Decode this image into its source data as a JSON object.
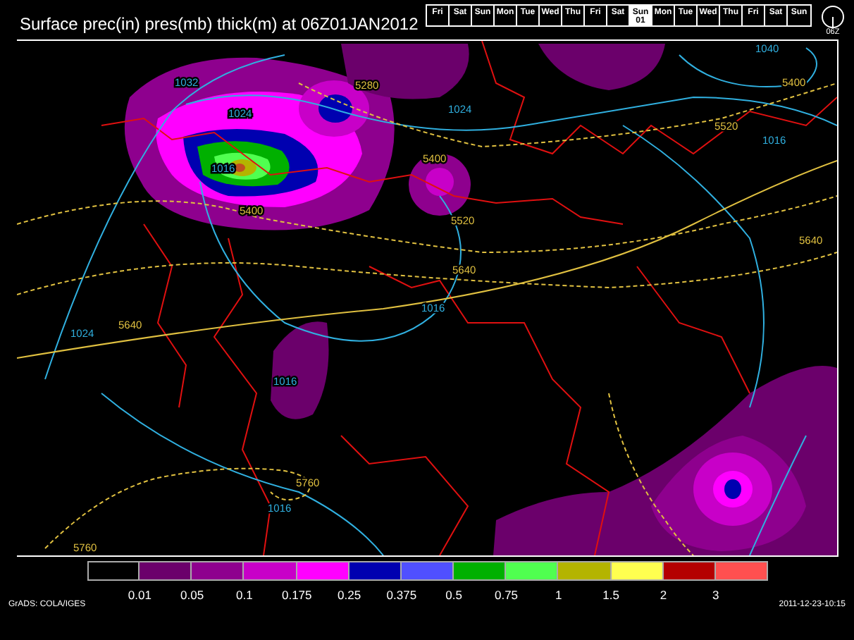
{
  "title": "Surface prec(in) pres(mb) thick(m) at 06Z01JAN2012",
  "days": [
    {
      "day": "Fri",
      "selected": false
    },
    {
      "day": "Sat",
      "selected": false
    },
    {
      "day": "Sun",
      "selected": false
    },
    {
      "day": "Mon",
      "selected": false
    },
    {
      "day": "Tue",
      "selected": false
    },
    {
      "day": "Wed",
      "selected": false
    },
    {
      "day": "Thu",
      "selected": false
    },
    {
      "day": "Fri",
      "selected": false
    },
    {
      "day": "Sat",
      "selected": false
    },
    {
      "day": "Sun",
      "date": "01",
      "selected": true
    },
    {
      "day": "Mon",
      "selected": false
    },
    {
      "day": "Tue",
      "selected": false
    },
    {
      "day": "Wed",
      "selected": false
    },
    {
      "day": "Thu",
      "selected": false
    },
    {
      "day": "Fri",
      "selected": false
    },
    {
      "day": "Sat",
      "selected": false
    },
    {
      "day": "Sun",
      "selected": false
    }
  ],
  "clock_label": "06Z",
  "map": {
    "contour_labels": [
      {
        "text": "1032",
        "kind": "isobar"
      },
      {
        "text": "1024",
        "kind": "isobar"
      },
      {
        "text": "5280",
        "kind": "thickness"
      },
      {
        "text": "1024",
        "kind": "isobar"
      },
      {
        "text": "1040",
        "kind": "isobar"
      },
      {
        "text": "5400",
        "kind": "thickness"
      },
      {
        "text": "5520",
        "kind": "thickness"
      },
      {
        "text": "1016",
        "kind": "isobar"
      },
      {
        "text": "1016",
        "kind": "isobar"
      },
      {
        "text": "5400",
        "kind": "thickness"
      },
      {
        "text": "5400",
        "kind": "thickness"
      },
      {
        "text": "5520",
        "kind": "thickness"
      },
      {
        "text": "5640",
        "kind": "thickness"
      },
      {
        "text": "5640",
        "kind": "thickness"
      },
      {
        "text": "1016",
        "kind": "isobar"
      },
      {
        "text": "5640",
        "kind": "thickness"
      },
      {
        "text": "1024",
        "kind": "isobar"
      },
      {
        "text": "1016",
        "kind": "isobar"
      },
      {
        "text": "5760",
        "kind": "thickness"
      },
      {
        "text": "1016",
        "kind": "isobar"
      },
      {
        "text": "5760",
        "kind": "thickness"
      }
    ]
  },
  "colorbar": {
    "segments": [
      {
        "color": "#000000"
      },
      {
        "color": "#6b006b"
      },
      {
        "color": "#8e008e"
      },
      {
        "color": "#c800c8"
      },
      {
        "color": "#ff00ff"
      },
      {
        "color": "#0000b0"
      },
      {
        "color": "#5050ff"
      },
      {
        "color": "#00b000"
      },
      {
        "color": "#50ff50"
      },
      {
        "color": "#b4b400"
      },
      {
        "color": "#ffff50"
      },
      {
        "color": "#b40000"
      },
      {
        "color": "#ff5050"
      }
    ],
    "labels": [
      "0.01",
      "0.05",
      "0.1",
      "0.175",
      "0.25",
      "0.375",
      "0.5",
      "0.75",
      "1",
      "1.5",
      "2",
      "3"
    ]
  },
  "footer": {
    "left": "GrADS: COLA/IGES",
    "right": "2011-12-23-10:15"
  }
}
